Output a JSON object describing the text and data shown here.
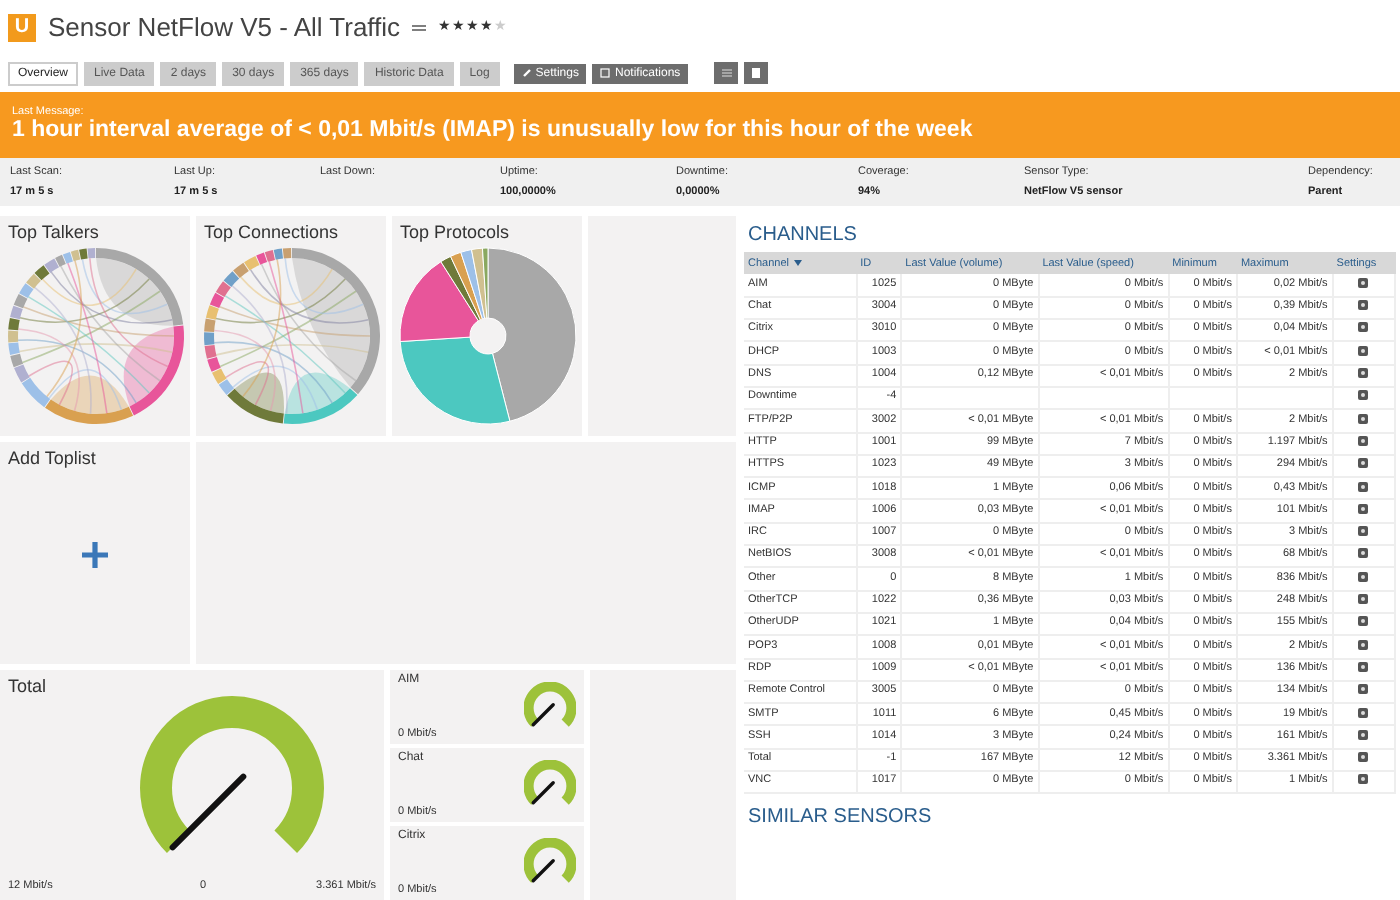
{
  "header": {
    "logo": "U",
    "title": "Sensor NetFlow V5 - All Traffic",
    "stars": 4
  },
  "tabs": [
    {
      "label": "Overview",
      "selected": true
    },
    {
      "label": "Live Data",
      "selected": false
    },
    {
      "label": "2 days",
      "selected": false
    },
    {
      "label": "30 days",
      "selected": false
    },
    {
      "label": "365 days",
      "selected": false
    },
    {
      "label": "Historic Data",
      "selected": false
    },
    {
      "label": "Log",
      "selected": false
    }
  ],
  "actions": [
    {
      "label": "Settings",
      "kind": "settings"
    },
    {
      "label": "Notifications",
      "kind": "notifications"
    }
  ],
  "message": {
    "label": "Last Message:",
    "text": "1 hour interval average of < 0,01 Mbit/s (IMAP) is unusually low for this hour of the week"
  },
  "stats": [
    {
      "label": "Last Scan:",
      "value": "17 m 5 s"
    },
    {
      "label": "Last Up:",
      "value": "17 m 5 s"
    },
    {
      "label": "Last Down:"
    },
    {
      "label": "Uptime:",
      "value": "100,0000%"
    },
    {
      "label": "Downtime:",
      "value": "0,0000%"
    },
    {
      "label": "Coverage:",
      "value": "94%"
    },
    {
      "label": "Sensor Type:",
      "value": "NetFlow V5 sensor"
    },
    {
      "label": "Dependency:",
      "value": "Parent"
    }
  ],
  "toplists": [
    {
      "title": "Top Talkers",
      "kind": "chord"
    },
    {
      "title": "Top Connections",
      "kind": "chord"
    },
    {
      "title": "Top Protocols",
      "kind": "pie"
    }
  ],
  "add_toplist": {
    "title": "Add Toplist"
  },
  "total_gauge": {
    "title": "Total",
    "value": "12 Mbit/s",
    "min": "0",
    "max": "3.361 Mbit/s"
  },
  "small_gauges": [
    {
      "title": "AIM",
      "value": "0 Mbit/s"
    },
    {
      "title": "Chat",
      "value": "0 Mbit/s"
    },
    {
      "title": "Citrix",
      "value": "0 Mbit/s"
    }
  ],
  "channels": {
    "title": "CHANNELS",
    "columns": [
      "Channel",
      "ID",
      "Last Value (volume)",
      "Last Value (speed)",
      "Minimum",
      "Maximum",
      "Settings"
    ],
    "rows": [
      [
        "AIM",
        "1025",
        "0 MByte",
        "0 Mbit/s",
        "0 Mbit/s",
        "0,02 Mbit/s"
      ],
      [
        "Chat",
        "3004",
        "0 MByte",
        "0 Mbit/s",
        "0 Mbit/s",
        "0,39 Mbit/s"
      ],
      [
        "Citrix",
        "3010",
        "0 MByte",
        "0 Mbit/s",
        "0 Mbit/s",
        "0,04 Mbit/s"
      ],
      [
        "DHCP",
        "1003",
        "0 MByte",
        "0 Mbit/s",
        "0 Mbit/s",
        "< 0,01 Mbit/s"
      ],
      [
        "DNS",
        "1004",
        "0,12 MByte",
        "< 0,01 Mbit/s",
        "0 Mbit/s",
        "2 Mbit/s"
      ],
      [
        "Downtime",
        "-4",
        "",
        "",
        "",
        ""
      ],
      [
        "FTP/P2P",
        "3002",
        "< 0,01 MByte",
        "< 0,01 Mbit/s",
        "0 Mbit/s",
        "2 Mbit/s"
      ],
      [
        "HTTP",
        "1001",
        "99 MByte",
        "7 Mbit/s",
        "0 Mbit/s",
        "1.197 Mbit/s"
      ],
      [
        "HTTPS",
        "1023",
        "49 MByte",
        "3 Mbit/s",
        "0 Mbit/s",
        "294 Mbit/s"
      ],
      [
        "ICMP",
        "1018",
        "1 MByte",
        "0,06 Mbit/s",
        "0 Mbit/s",
        "0,43 Mbit/s"
      ],
      [
        "IMAP",
        "1006",
        "0,03 MByte",
        "< 0,01 Mbit/s",
        "0 Mbit/s",
        "101 Mbit/s"
      ],
      [
        "IRC",
        "1007",
        "0 MByte",
        "0 Mbit/s",
        "0 Mbit/s",
        "3 Mbit/s"
      ],
      [
        "NetBIOS",
        "3008",
        "< 0,01 MByte",
        "< 0,01 Mbit/s",
        "0 Mbit/s",
        "68 Mbit/s"
      ],
      [
        "Other",
        "0",
        "8 MByte",
        "1 Mbit/s",
        "0 Mbit/s",
        "836 Mbit/s"
      ],
      [
        "OtherTCP",
        "1022",
        "0,36 MByte",
        "0,03 Mbit/s",
        "0 Mbit/s",
        "248 Mbit/s"
      ],
      [
        "OtherUDP",
        "1021",
        "1 MByte",
        "0,04 Mbit/s",
        "0 Mbit/s",
        "155 Mbit/s"
      ],
      [
        "POP3",
        "1008",
        "0,01 MByte",
        "< 0,01 Mbit/s",
        "0 Mbit/s",
        "2 Mbit/s"
      ],
      [
        "RDP",
        "1009",
        "< 0,01 MByte",
        "< 0,01 Mbit/s",
        "0 Mbit/s",
        "136 Mbit/s"
      ],
      [
        "Remote Control",
        "3005",
        "0 MByte",
        "0 Mbit/s",
        "0 Mbit/s",
        "134 Mbit/s"
      ],
      [
        "SMTP",
        "1011",
        "6 MByte",
        "0,45 Mbit/s",
        "0 Mbit/s",
        "19 Mbit/s"
      ],
      [
        "SSH",
        "1014",
        "3 MByte",
        "0,24 Mbit/s",
        "0 Mbit/s",
        "161 Mbit/s"
      ],
      [
        "Total",
        "-1",
        "167 MByte",
        "12 Mbit/s",
        "0 Mbit/s",
        "3.361 Mbit/s"
      ],
      [
        "VNC",
        "1017",
        "0 MByte",
        "0 Mbit/s",
        "0 Mbit/s",
        "1 Mbit/s"
      ]
    ]
  },
  "similar": {
    "title": "SIMILAR SENSORS"
  }
}
